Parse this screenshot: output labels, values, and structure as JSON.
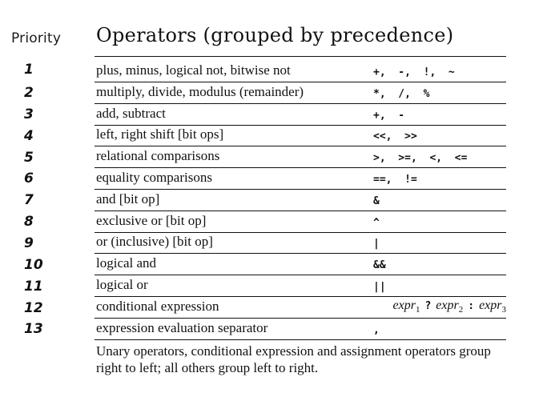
{
  "header": {
    "priority_label": "Priority",
    "title": "Operators (grouped by precedence)"
  },
  "rows": [
    {
      "priority": "1",
      "description": "plus, minus, logical not, bitwise not",
      "operators": "+,  -,  !,  ~"
    },
    {
      "priority": "2",
      "description": "multiply, divide, modulus (remainder)",
      "operators": "*,  /,  %"
    },
    {
      "priority": "3",
      "description": "add, subtract",
      "operators": "+,  -"
    },
    {
      "priority": "4",
      "description": "left, right shift [bit ops]",
      "operators": "<<,  >>"
    },
    {
      "priority": "5",
      "description": "relational comparisons",
      "operators": ">,  >=,  <,  <="
    },
    {
      "priority": "6",
      "description": "equality comparisons",
      "operators": "==,  !="
    },
    {
      "priority": "7",
      "description": "and [bit op]",
      "operators": "&"
    },
    {
      "priority": "8",
      "description": "exclusive or [bit op]",
      "operators": "^"
    },
    {
      "priority": "9",
      "description": "or (inclusive) [bit op]",
      "operators": "|"
    },
    {
      "priority": "10",
      "description": "logical and",
      "operators": "&&"
    },
    {
      "priority": "11",
      "description": "logical or",
      "operators": "||"
    },
    {
      "priority": "12",
      "description": "conditional expression",
      "operators_conditional": {
        "e1": "expr",
        "s1": "1",
        "q": "?",
        "e2": "expr",
        "s2": "2",
        "c": ":",
        "e3": "expr",
        "s3": "3"
      }
    },
    {
      "priority": "13",
      "description": "expression evaluation separator",
      "operators": ","
    }
  ],
  "note": "Unary operators, conditional expression and assignment operators group right to left; all others group left to right."
}
